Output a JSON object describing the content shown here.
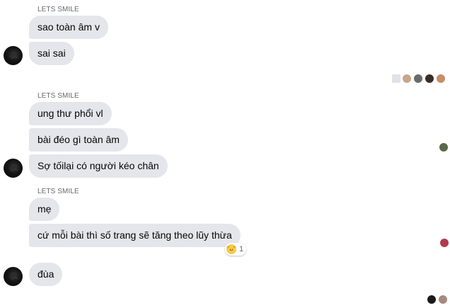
{
  "groups": [
    {
      "sender": "LETS SMILE",
      "messages": [
        "sao toàn âm v",
        "sai sai"
      ]
    },
    {
      "sender": "LETS SMILE",
      "messages": [
        "ung thư phổi vl",
        "bài đéo gì toàn âm",
        "Sợ tốilại có người kéo chân"
      ]
    },
    {
      "sender": "LETS SMILE",
      "messages": [
        "mẹ",
        "cứ mỗi bài thì số trang sẽ tăng theo lũy thừa",
        "đùa"
      ]
    }
  ],
  "reaction": {
    "emoji_icon": "laughing-emoji-icon",
    "count": "1"
  },
  "colors": {
    "bubble": "#e4e6eb",
    "sender_text": "#65676b",
    "message_text": "#050505"
  }
}
